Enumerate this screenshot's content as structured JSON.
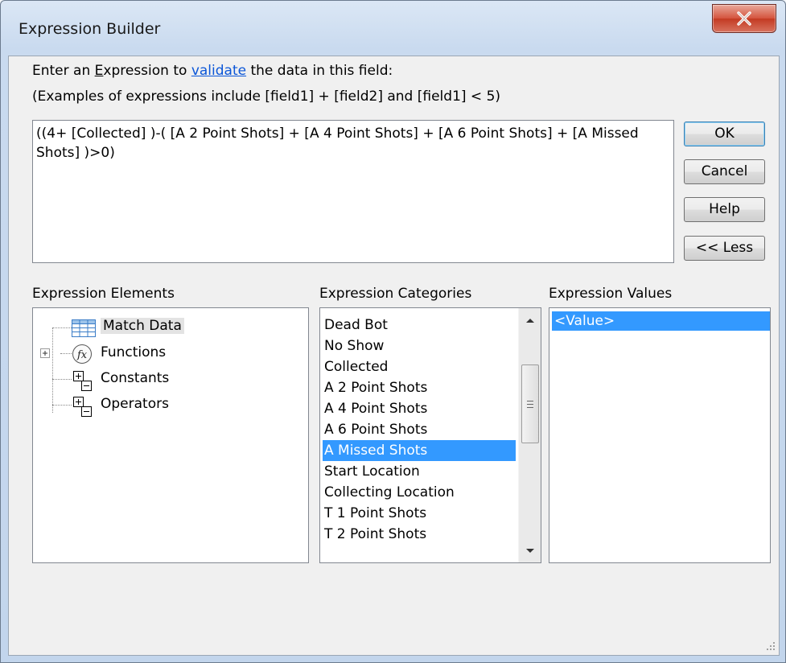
{
  "window": {
    "title": "Expression Builder",
    "close_label": "x"
  },
  "prompt": {
    "line1_before": "Enter an ",
    "line1_e": "E",
    "line1_rest": "xpression to ",
    "line1_link": "validate",
    "line1_after": " the data in this field:",
    "line2": "(Examples of expressions include [field1] + [field2] and [field1] < 5)"
  },
  "expression": {
    "value": "((4+ [Collected] )-( [A 2 Point Shots] + [A 4 Point Shots] + [A 6 Point Shots] + [A Missed Shots] )>0)"
  },
  "buttons": {
    "ok": "OK",
    "cancel": "Cancel",
    "help": "Help",
    "less": "<< Less"
  },
  "sections": {
    "elements": "Expression Elements",
    "categories": "Expression Categories",
    "values": "Expression Values"
  },
  "elements": [
    {
      "label": "Match Data",
      "icon": "table-icon",
      "selected": true
    },
    {
      "label": "Functions",
      "icon": "function-icon",
      "expandable": true
    },
    {
      "label": "Constants",
      "icon": "constants-icon"
    },
    {
      "label": "Operators",
      "icon": "operators-icon"
    }
  ],
  "categories": [
    "Dead Bot",
    "No Show",
    "Collected",
    "A 2 Point Shots",
    "A 4 Point Shots",
    "A 6 Point Shots",
    "A Missed Shots",
    "Start Location",
    "Collecting Location",
    "T 1 Point Shots",
    "T 2 Point Shots"
  ],
  "selected_category": "A Missed Shots",
  "values": [
    "<Value>"
  ],
  "colors": {
    "selection": "#3399ff",
    "link": "#0b56d8",
    "close": "#c33a22"
  }
}
